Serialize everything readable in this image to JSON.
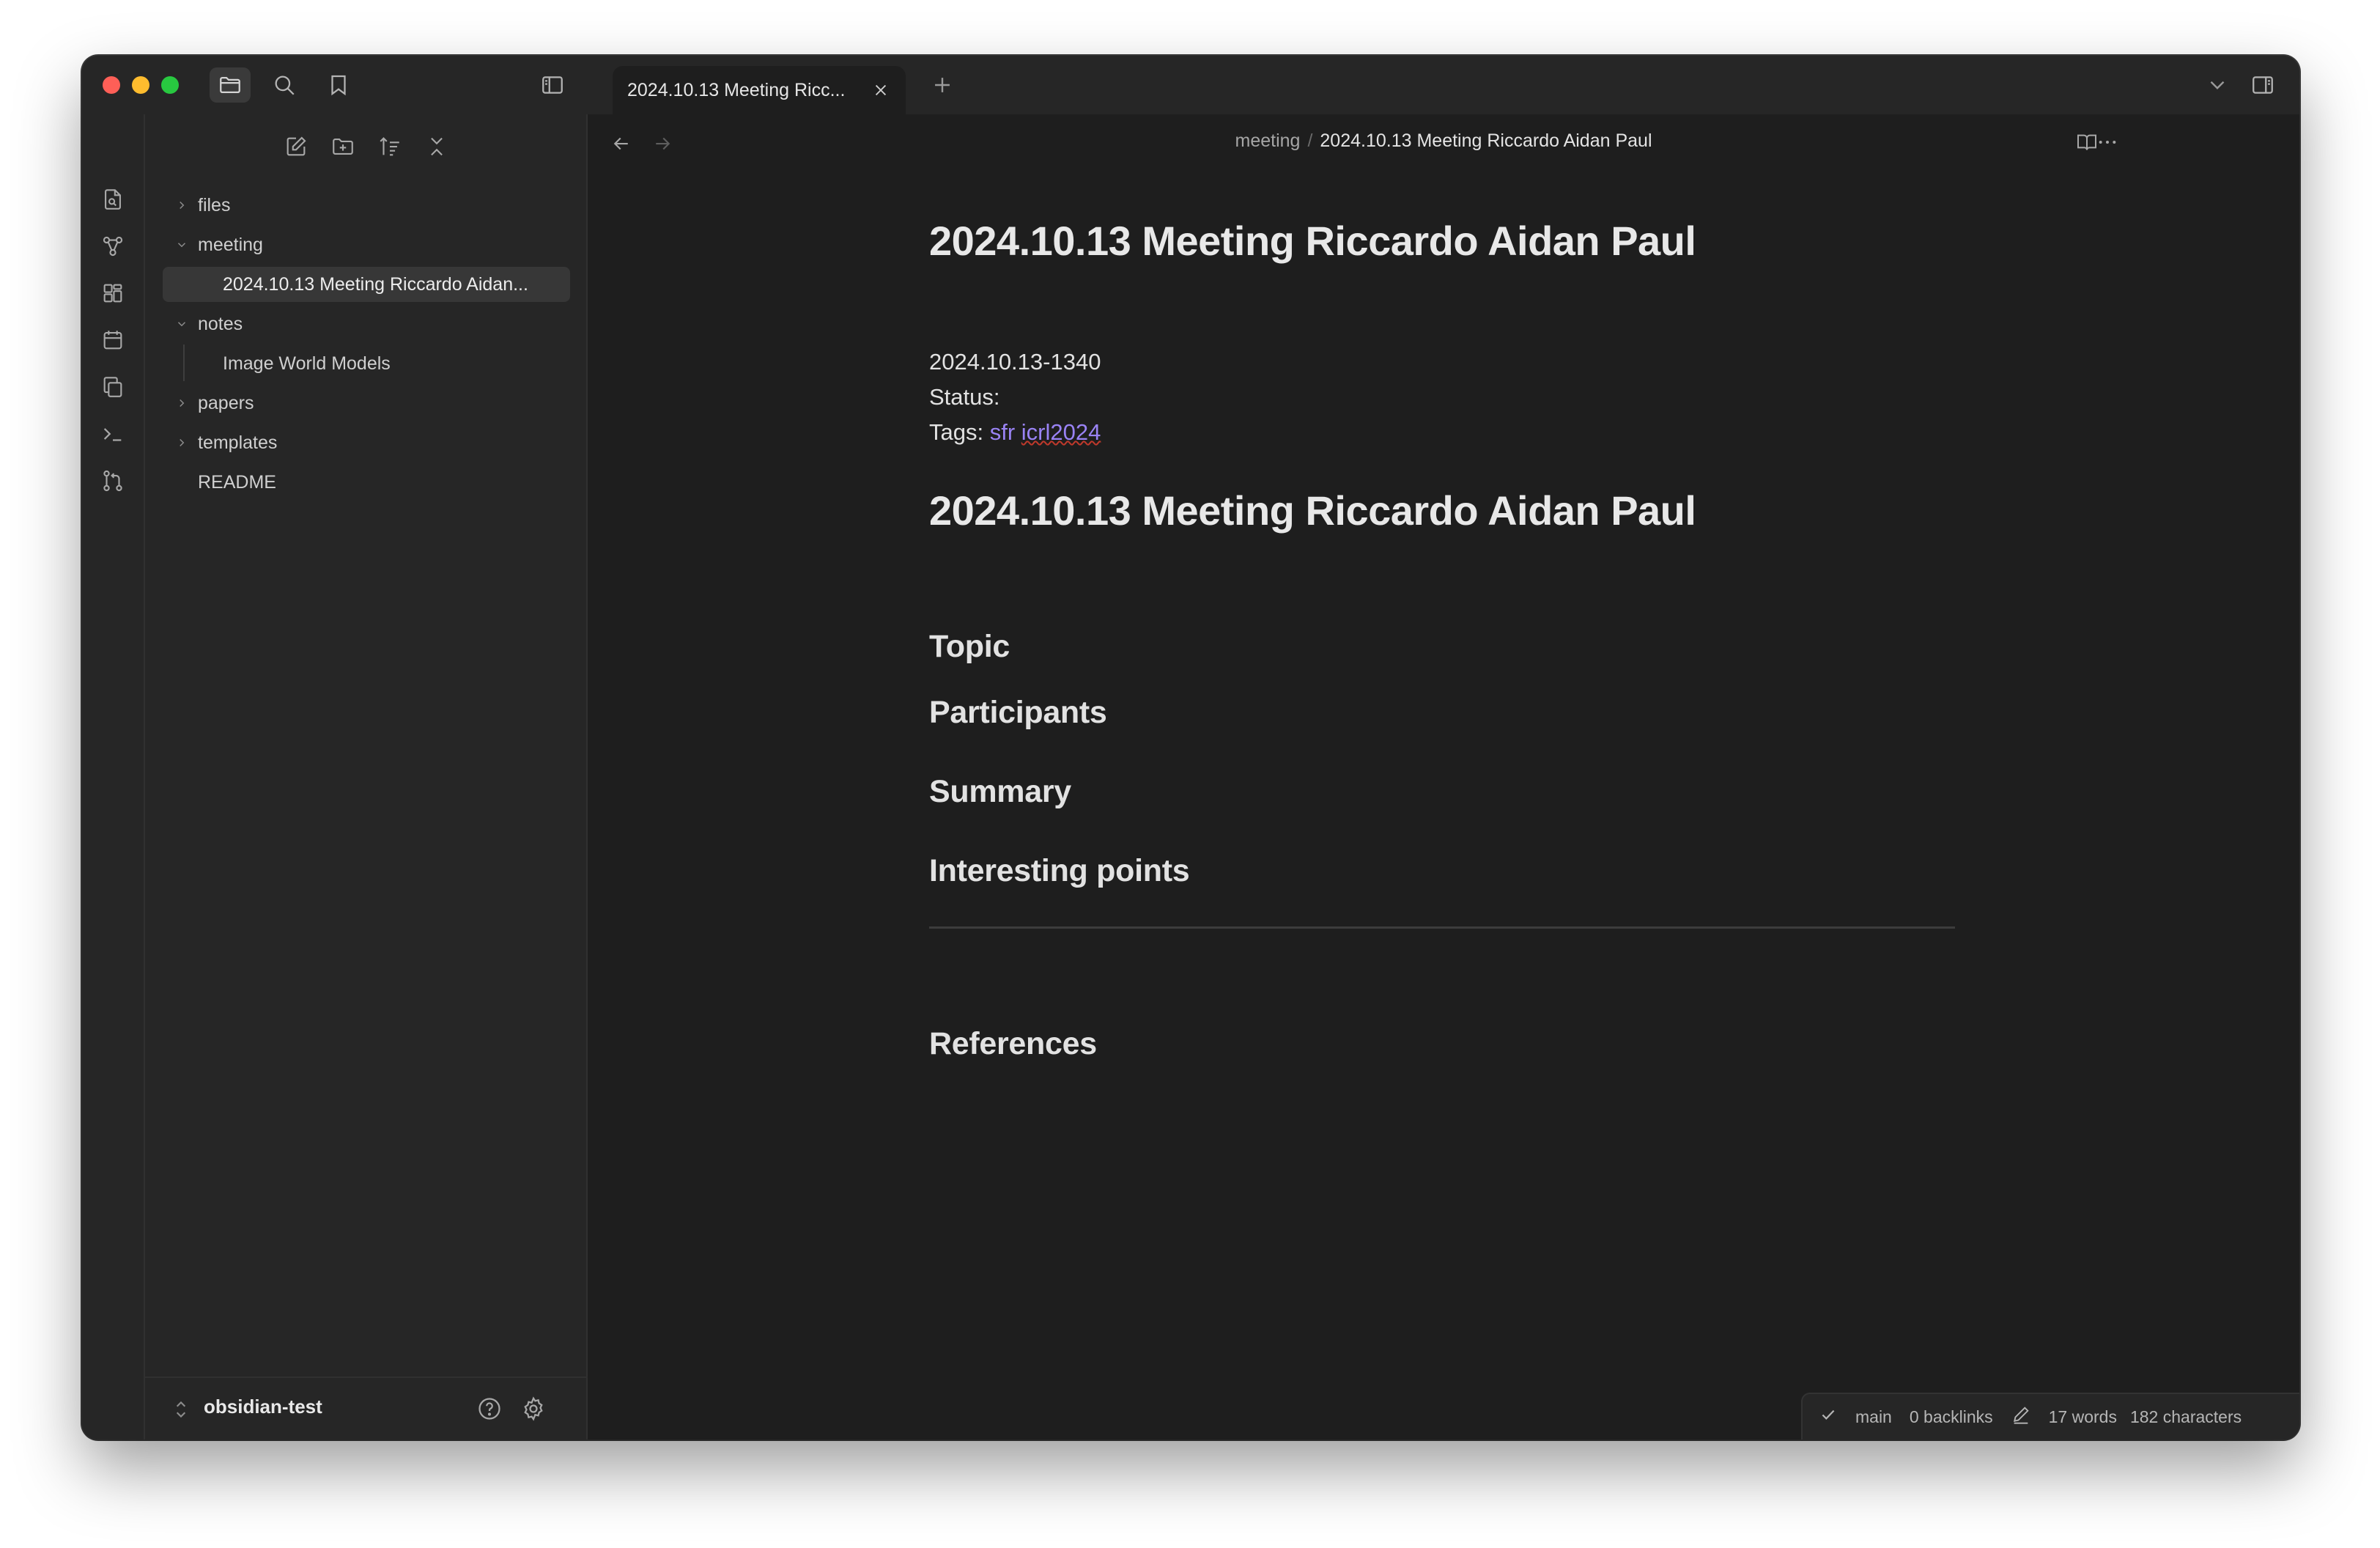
{
  "tab": {
    "title": "2024.10.13 Meeting Ricc..."
  },
  "sidebar": {
    "tree": [
      {
        "label": "files",
        "expanded": false
      },
      {
        "label": "meeting",
        "expanded": true
      },
      {
        "label": "2024.10.13 Meeting Riccardo Aidan...",
        "selected": true
      },
      {
        "label": "notes",
        "expanded": true
      },
      {
        "label": "Image World Models"
      },
      {
        "label": "papers",
        "expanded": false
      },
      {
        "label": "templates",
        "expanded": false
      },
      {
        "label": "README"
      }
    ],
    "vault_name": "obsidian-test"
  },
  "breadcrumb": {
    "folder": "meeting",
    "separator": "/",
    "file": "2024.10.13 Meeting Riccardo Aidan Paul"
  },
  "document": {
    "title": "2024.10.13 Meeting Riccardo Aidan Paul",
    "timestamp": "2024.10.13-1340",
    "status_label": "Status:",
    "tags_label": "Tags:",
    "tags": [
      "sfr",
      "icrl2024"
    ],
    "heading": "2024.10.13 Meeting Riccardo Aidan Paul",
    "sections": [
      "Topic",
      "Participants",
      "Summary",
      "Interesting points"
    ],
    "references": "References"
  },
  "statusbar": {
    "branch": "main",
    "backlinks": "0 backlinks",
    "words": "17 words",
    "characters": "182 characters"
  },
  "colors": {
    "background": "#1e1e1e",
    "panel": "#262626",
    "tag": "#9a83f5",
    "close": "#fe5f57",
    "minimize": "#febc2e",
    "zoom": "#28c840"
  }
}
